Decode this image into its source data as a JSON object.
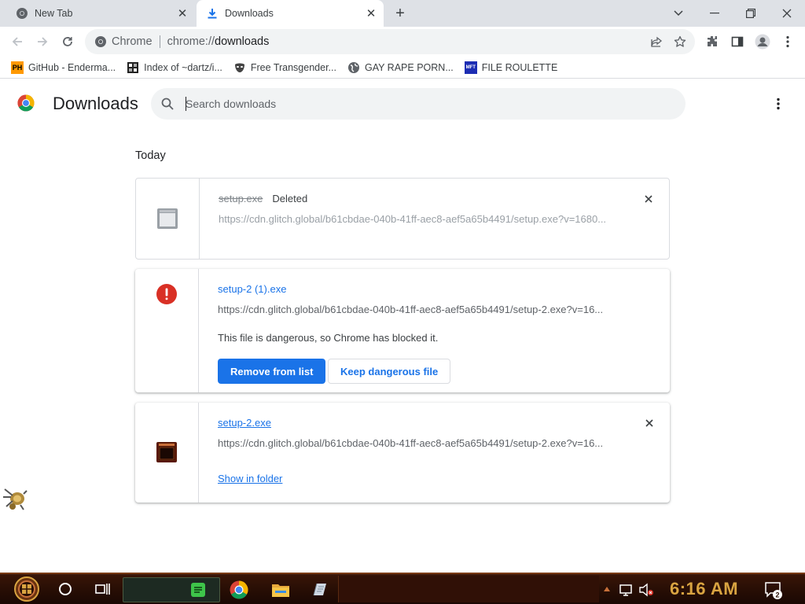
{
  "browser": {
    "tabs": [
      {
        "title": "New Tab",
        "active": false
      },
      {
        "title": "Downloads",
        "active": true
      }
    ],
    "omnibox": {
      "site_label": "Chrome",
      "url_scheme": "chrome://",
      "url_host": "downloads"
    },
    "bookmarks": [
      {
        "label": "GitHub - Enderma...",
        "icon": "PH"
      },
      {
        "label": "Index of ~dartz/i...",
        "icon": "index-icon"
      },
      {
        "label": "Free Transgender...",
        "icon": "mask-icon"
      },
      {
        "label": "GAY RAPE PORN...",
        "icon": "globe-icon"
      },
      {
        "label": "FILE ROULETTE",
        "icon": "MFT"
      }
    ]
  },
  "downloads_page": {
    "title": "Downloads",
    "search_placeholder": "Search downloads",
    "section_date": "Today",
    "items": [
      {
        "filename": "setup.exe",
        "status": "Deleted",
        "url": "https://cdn.glitch.global/b61cbdae-040b-41ff-aec8-aef5a65b4491/setup.exe?v=1680..."
      },
      {
        "filename": "setup-2 (1).exe",
        "url": "https://cdn.glitch.global/b61cbdae-040b-41ff-aec8-aef5a65b4491/setup-2.exe?v=16...",
        "warning": "This file is dangerous, so Chrome has blocked it.",
        "primary_action": "Remove from list",
        "secondary_action": "Keep dangerous file"
      },
      {
        "filename": "setup-2.exe",
        "url": "https://cdn.glitch.global/b61cbdae-040b-41ff-aec8-aef5a65b4491/setup-2.exe?v=16...",
        "action_link": "Show in folder"
      }
    ]
  },
  "taskbar": {
    "clock": "6:16 AM",
    "notification_count": "2"
  },
  "colors": {
    "accent": "#1a73e8",
    "danger": "#d93025",
    "clock": "#d9a441"
  }
}
